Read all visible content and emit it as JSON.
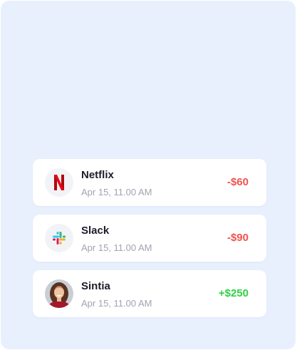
{
  "colors": {
    "panel_background": "#e9f0fd",
    "card_background": "#ffffff",
    "negative_amount": "#f0534f",
    "positive_amount": "#2fcf45",
    "netflix_red": "#e50914"
  },
  "transactions": [
    {
      "name": "Netflix",
      "date": "Apr 15, 11.00 AM",
      "amount": "-$60",
      "icon": "netflix-logo-icon"
    },
    {
      "name": "Slack",
      "date": "Apr 15, 11.00 AM",
      "amount": "-$90",
      "icon": "slack-logo-icon"
    },
    {
      "name": "Sintia",
      "date": "Apr 15, 11.00 AM",
      "amount": "+$250",
      "icon": "user-avatar-photo"
    }
  ]
}
